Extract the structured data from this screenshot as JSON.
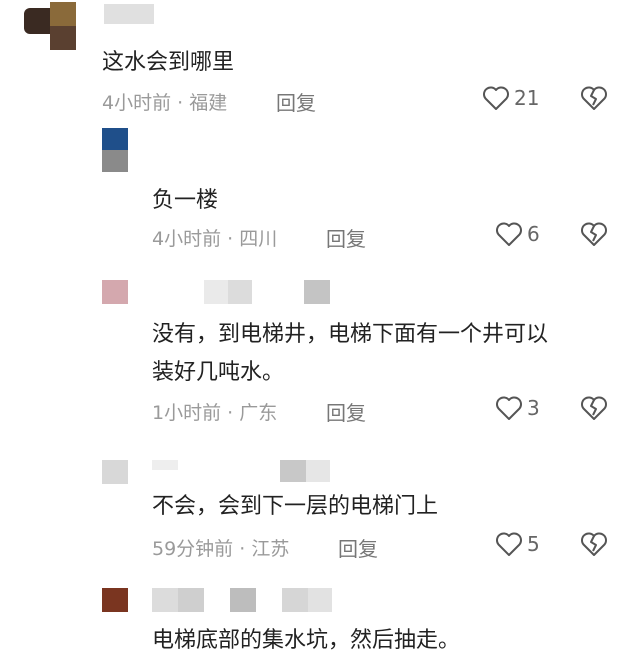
{
  "comments": [
    {
      "text": "这水会到哪里",
      "time": "4小时前",
      "location": "福建",
      "reply_label": "回复",
      "likes": "21"
    },
    {
      "text": "负一楼",
      "time": "4小时前",
      "location": "四川",
      "reply_label": "回复",
      "likes": "6"
    },
    {
      "text_line1": "没有，到电梯井，电梯下面有一个井可以",
      "text_line2": "装好几吨水。",
      "time": "1小时前",
      "location": "广东",
      "reply_label": "回复",
      "likes": "3"
    },
    {
      "text": "不会，会到下一层的电梯门上",
      "time": "59分钟前",
      "location": "江苏",
      "reply_label": "回复",
      "likes": "5"
    },
    {
      "text": "电梯底部的集水坑，然后抽走。"
    }
  ],
  "separator": " · ",
  "icons": {
    "like": "heart-outline-icon",
    "dislike": "broken-heart-outline-icon"
  },
  "colors": {
    "text": "#222222",
    "meta": "#9a9a9a",
    "icon": "#555555"
  }
}
